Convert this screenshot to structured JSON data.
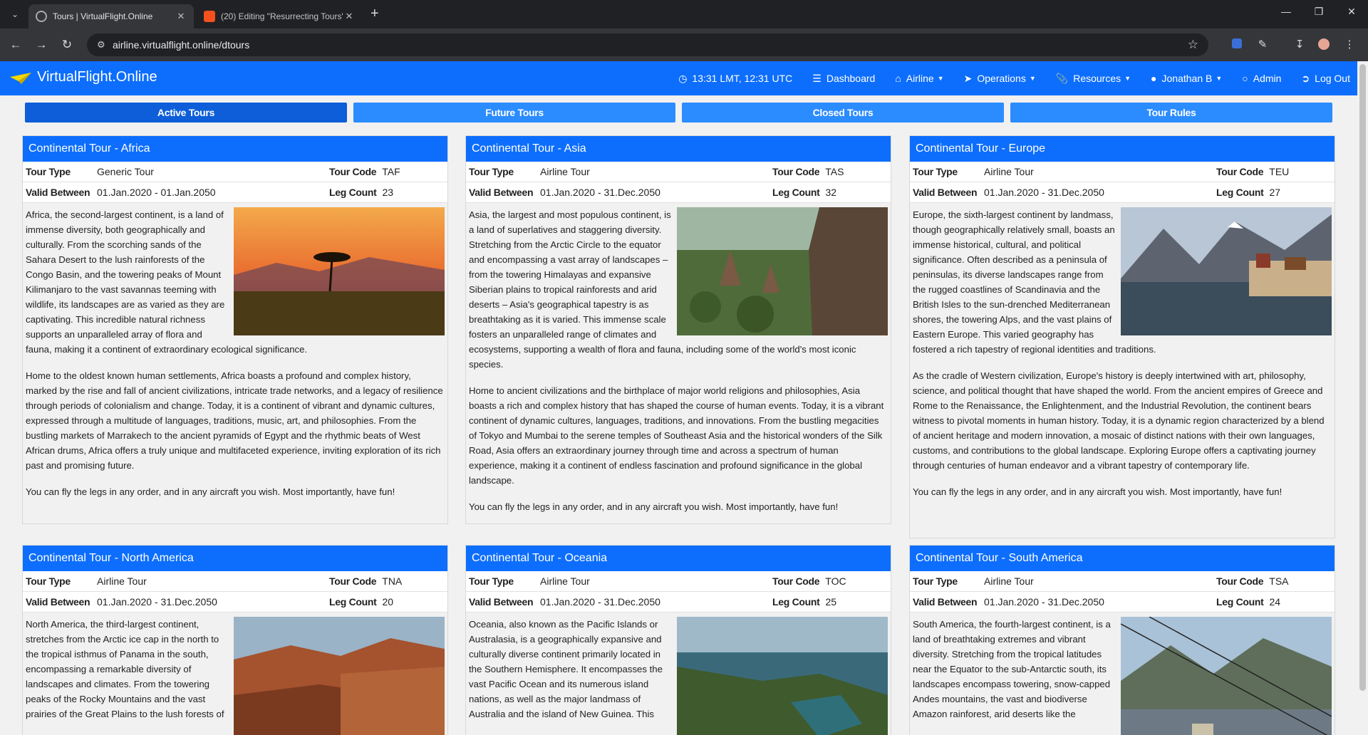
{
  "browser": {
    "tabs": [
      {
        "title": "Tours | VirtualFlight.Online",
        "active": true
      },
      {
        "title": "(20) Editing \"Resurrecting Tours\"",
        "active": false
      }
    ],
    "url": "airline.virtualflight.online/dtours"
  },
  "site": {
    "brand": "VirtualFlight.Online",
    "nav": {
      "time": "13:31 LMT, 12:31 UTC",
      "dashboard": "Dashboard",
      "airline": "Airline",
      "operations": "Operations",
      "resources": "Resources",
      "user": "Jonathan B",
      "admin": "Admin",
      "logout": "Log Out"
    },
    "tour_tabs": [
      "Active Tours",
      "Future Tours",
      "Closed Tours",
      "Tour Rules"
    ]
  },
  "labels": {
    "tour_type": "Tour Type",
    "tour_code": "Tour Code",
    "valid_between": "Valid Between",
    "leg_count": "Leg Count"
  },
  "tours": [
    {
      "title": "Continental Tour - Africa",
      "type": "Generic Tour",
      "code": "TAF",
      "valid": "01.Jan.2020 - 01.Jan.2050",
      "legs": "23",
      "image": "savanna-sunset",
      "p1": "Africa, the second-largest continent, is a land of immense diversity, both geographically and culturally. From the scorching sands of the Sahara Desert to the lush rainforests of the Congo Basin, and the towering peaks of Mount Kilimanjaro to the vast savannas teeming with wildlife, its landscapes are as varied as they are captivating. This incredible natural richness supports an unparalleled array of flora and fauna, making it a continent of extraordinary ecological significance.",
      "p2": "Home to the oldest known human settlements, Africa boasts a profound and complex history, marked by the rise and fall of ancient civilizations, intricate trade networks, and a legacy of resilience through periods of colonialism and change. Today, it is a continent of vibrant and dynamic cultures, expressed through a multitude of languages, traditions, music, art, and philosophies. From the bustling markets of Marrakech to the ancient pyramids of Egypt and the rhythmic beats of West African drums, Africa offers a truly unique and multifaceted experience, inviting exploration of its rich past and promising future.",
      "p3": "You can fly the legs in any order, and in any aircraft you wish. Most importantly, have fun!"
    },
    {
      "title": "Continental Tour - Asia",
      "type": "Airline Tour",
      "code": "TAS",
      "valid": "01.Jan.2020 - 31.Dec.2050",
      "legs": "32",
      "image": "temple-jungle",
      "p1": "Asia, the largest and most populous continent, is a land of superlatives and staggering diversity. Stretching from the Arctic Circle to the equator and encompassing a vast array of landscapes – from the towering Himalayas and expansive Siberian plains to tropical rainforests and arid deserts – Asia's geographical tapestry is as breathtaking as it is varied. This immense scale fosters an unparalleled range of climates and ecosystems, supporting a wealth of flora and fauna, including some of the world's most iconic species.",
      "p2": "Home to ancient civilizations and the birthplace of major world religions and philosophies, Asia boasts a rich and complex history that has shaped the course of human events. Today, it is a vibrant continent of dynamic cultures, languages, traditions, and innovations. From the bustling megacities of Tokyo and Mumbai to the serene temples of Southeast Asia and the historical wonders of the Silk Road, Asia offers an extraordinary journey through time and across a spectrum of human experience, making it a continent of endless fascination and profound significance in the global landscape.",
      "p3": "You can fly the legs in any order, and in any aircraft you wish. Most importantly, have fun!"
    },
    {
      "title": "Continental Tour - Europe",
      "type": "Airline Tour",
      "code": "TEU",
      "valid": "01.Jan.2020 - 31.Dec.2050",
      "legs": "27",
      "image": "alpine-lake-village",
      "p1": "Europe, the sixth-largest continent by landmass, though geographically relatively small, boasts an immense historical, cultural, and political significance. Often described as a peninsula of peninsulas, its diverse landscapes range from the rugged coastlines of Scandinavia and the British Isles to the sun-drenched Mediterranean shores, the towering Alps, and the vast plains of Eastern Europe. This varied geography has fostered a rich tapestry of regional identities and traditions.",
      "p2": "As the cradle of Western civilization, Europe's history is deeply intertwined with art, philosophy, science, and political thought that have shaped the world. From the ancient empires of Greece and Rome to the Renaissance, the Enlightenment, and the Industrial Revolution, the continent bears witness to pivotal moments in human history. Today, it is a dynamic region characterized by a blend of ancient heritage and modern innovation, a mosaic of distinct nations with their own languages, customs, and contributions to the global landscape. Exploring Europe offers a captivating journey through centuries of human endeavor and a vibrant tapestry of contemporary life.",
      "p3": "You can fly the legs in any order, and in any aircraft you wish. Most importantly, have fun!"
    },
    {
      "title": "Continental Tour - North America",
      "type": "Airline Tour",
      "code": "TNA",
      "valid": "01.Jan.2020 - 31.Dec.2050",
      "legs": "20",
      "image": "red-rock-canyon",
      "p1": "North America, the third-largest continent, stretches from the Arctic ice cap in the north to the tropical isthmus of Panama in the south, encompassing a remarkable diversity of landscapes and climates. From the towering peaks of the Rocky Mountains and the vast prairies of the Great Plains to the lush forests of",
      "p2": "",
      "p3": ""
    },
    {
      "title": "Continental Tour - Oceania",
      "type": "Airline Tour",
      "code": "TOC",
      "valid": "01.Jan.2020 - 31.Dec.2050",
      "legs": "25",
      "image": "coastline-aerial",
      "p1": "Oceania, also known as the Pacific Islands or Australasia, is a geographically expansive and culturally diverse continent primarily located in the Southern Hemisphere. It encompasses the vast Pacific Ocean and its numerous island nations, as well as the major landmass of Australia and the island of New Guinea. This",
      "p2": "",
      "p3": ""
    },
    {
      "title": "Continental Tour - South America",
      "type": "Airline Tour",
      "code": "TSA",
      "valid": "01.Jan.2020 - 31.Dec.2050",
      "legs": "24",
      "image": "rio-cable-car",
      "p1": "South America, the fourth-largest continent, is a land of breathtaking extremes and vibrant diversity. Stretching from the tropical latitudes near the Equator to the sub-Antarctic south, its landscapes encompass towering, snow-capped Andes mountains, the vast and biodiverse Amazon rainforest, arid deserts like the",
      "p2": "",
      "p3": ""
    }
  ]
}
